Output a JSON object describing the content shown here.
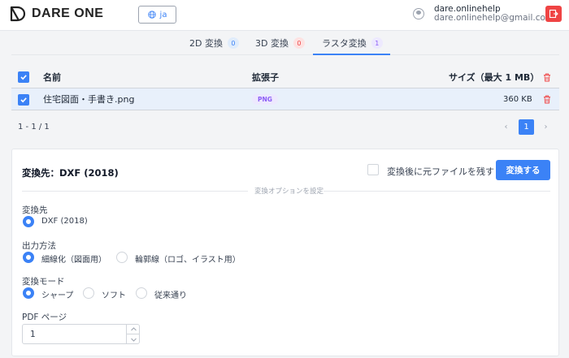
{
  "app": {
    "name": "DARE ONE"
  },
  "header": {
    "language": "ja",
    "user_name": "dare.onlinehelp",
    "user_email": "dare.onlinehelp@gmail.com"
  },
  "tabs": [
    {
      "label": "2D 変換",
      "count": "0",
      "badge_bg": "#e0ecfb",
      "badge_color": "#3b82f6"
    },
    {
      "label": "3D 変換",
      "count": "0",
      "badge_bg": "#fde2e2",
      "badge_color": "#ef4444"
    },
    {
      "label": "ラスタ変換",
      "count": "1",
      "badge_bg": "#ede9fe",
      "badge_color": "#8b5cf6",
      "active": true
    }
  ],
  "table": {
    "columns": {
      "name": "名前",
      "ext": "拡張子",
      "size": "サイズ（最大 1 MB）"
    },
    "rows": [
      {
        "name": "住宅図面・手書き.png",
        "ext": "PNG",
        "size": "360 KB"
      }
    ]
  },
  "pagination": {
    "range": "1 - 1 / 1",
    "current_page": "1",
    "prev": "‹",
    "next": "›"
  },
  "panel": {
    "title": "変換先：DXF (2018)",
    "keep_original_label": "変換後に元ファイルを残す",
    "keep_original_checked": false,
    "convert_button": "変換する",
    "options_divider": "変換オプションを設定",
    "target": {
      "label": "変換先",
      "options": [
        "DXF (2018)"
      ],
      "selected": 0
    },
    "output_method": {
      "label": "出力方法",
      "options": [
        "細線化（図面用）",
        "輪郭線（ロゴ、イラスト用）"
      ],
      "selected": 0
    },
    "conversion_mode": {
      "label": "変換モード",
      "options": [
        "シャープ",
        "ソフト",
        "従来通り"
      ],
      "selected": 0
    },
    "pdf_page": {
      "label": "PDF ページ",
      "value": "1"
    }
  },
  "colors": {
    "accent": "#3b82f6",
    "danger": "#ef4444",
    "png_badge": "#8b5cf6"
  },
  "icons": [
    "logo-icon",
    "globe-icon",
    "user-icon",
    "logout-icon",
    "trash-icon",
    "check-icon",
    "chevron-up-icon",
    "chevron-down-icon"
  ]
}
